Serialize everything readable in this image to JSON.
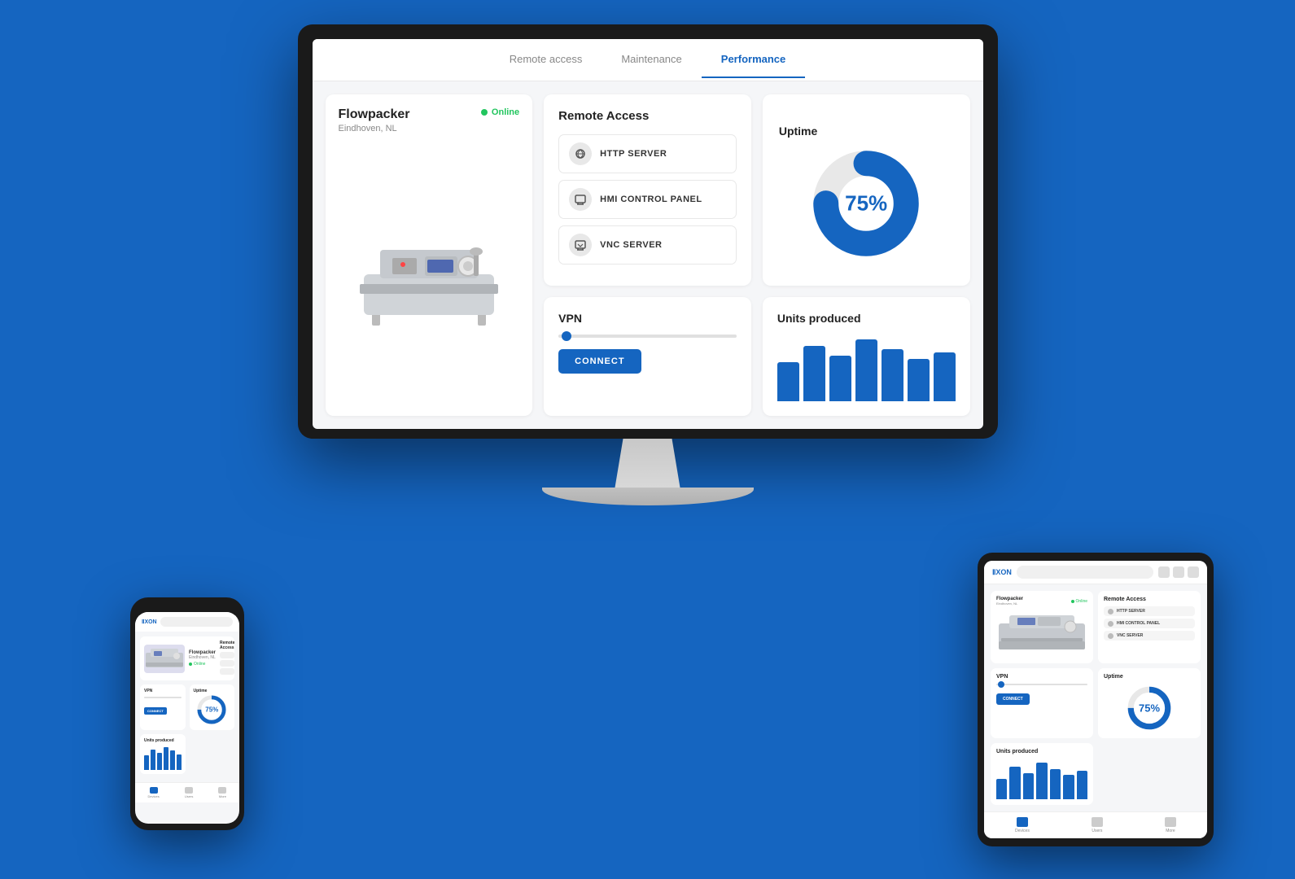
{
  "background": "#1565C0",
  "app": {
    "tabs": [
      {
        "id": "remote-access",
        "label": "Remote access",
        "active": false
      },
      {
        "id": "maintenance",
        "label": "Maintenance",
        "active": false
      },
      {
        "id": "performance",
        "label": "Performance",
        "active": true
      }
    ],
    "machine": {
      "name": "Flowpacker",
      "location": "Eindhoven, NL",
      "status": "Online"
    },
    "remote_access": {
      "title": "Remote Access",
      "items": [
        {
          "id": "http",
          "label": "HTTP SERVER"
        },
        {
          "id": "hmi",
          "label": "HMI CONTROL PANEL"
        },
        {
          "id": "vnc",
          "label": "VNC SERVER"
        }
      ]
    },
    "uptime": {
      "title": "Uptime",
      "value": 75,
      "display": "75%"
    },
    "vpn": {
      "title": "VPN",
      "connect_label": "CONNECT"
    },
    "units": {
      "title": "Units produced",
      "bars": [
        60,
        85,
        70,
        95,
        80,
        65,
        75
      ]
    }
  },
  "phone": {
    "logo": "ixon",
    "uptime_display": "75%",
    "bars": [
      60,
      85,
      70,
      95,
      80,
      65,
      75
    ],
    "nav_items": [
      "Devices",
      "Users",
      "More"
    ]
  },
  "tablet": {
    "logo": "ixon",
    "uptime_display": "75%",
    "bars": [
      50,
      80,
      65,
      90,
      75,
      60,
      70
    ],
    "nav_items": [
      "Devices",
      "Users",
      "More"
    ]
  }
}
